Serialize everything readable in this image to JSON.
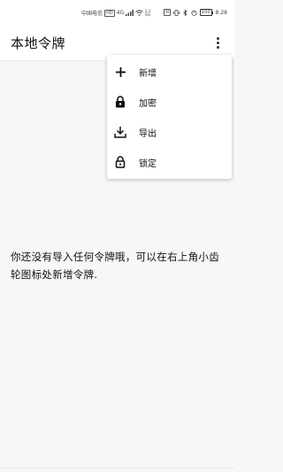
{
  "status_bar": {
    "carrier": "中国电信",
    "carrier_badge": "HD",
    "network": "4G",
    "speed_value": "2.1",
    "speed_unit": "K/s",
    "nfc_label": "N",
    "battery_level": "100",
    "time": "8:28"
  },
  "app_bar": {
    "title": "本地令牌"
  },
  "menu": {
    "items": [
      {
        "label": "新增",
        "icon": "plus-icon"
      },
      {
        "label": "加密",
        "icon": "lock-closed-icon"
      },
      {
        "label": "导出",
        "icon": "download-icon"
      },
      {
        "label": "锁定",
        "icon": "lock-open-icon"
      }
    ]
  },
  "content": {
    "empty_message": "你还没有导入任何令牌哦，可以在右上角小齿轮图标处新增令牌."
  }
}
